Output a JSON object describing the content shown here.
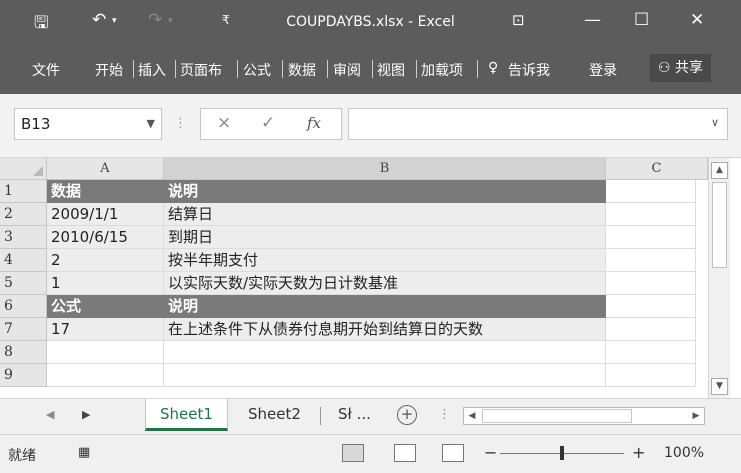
{
  "titlebar": {
    "save_icon": "save-icon",
    "undo_icon": "undo-icon",
    "redo_icon": "redo-icon",
    "title": "COUPDAYBS.xlsx - Excel",
    "ribbon_display_icon": "ribbon-display-icon",
    "minimize_icon": "minimize-icon",
    "maximize_icon": "maximize-icon",
    "close_icon": "close-icon"
  },
  "ribbon": {
    "tabs": [
      "文件",
      "开始",
      "插入",
      "页面布",
      "公式",
      "数据",
      "审阅",
      "视图",
      "加载项"
    ],
    "tell_me": "告诉我",
    "login": "登录",
    "share": "共享"
  },
  "formula_bar": {
    "name_box": "B13",
    "cancel": "×",
    "enter": "✓",
    "fx": "fx",
    "formula": ""
  },
  "columns": [
    "A",
    "B",
    "C"
  ],
  "rows": [
    {
      "num": "1",
      "a": "数据",
      "b": "说明",
      "style": "hdr"
    },
    {
      "num": "2",
      "a": "2009/1/1",
      "b": "结算日",
      "style": "data"
    },
    {
      "num": "3",
      "a": "2010/6/15",
      "b": "到期日",
      "style": "data"
    },
    {
      "num": "4",
      "a": "2",
      "b": "按半年期支付",
      "style": "data"
    },
    {
      "num": "5",
      "a": "1",
      "b": "以实际天数/实际天数为日计数基准",
      "style": "data"
    },
    {
      "num": "6",
      "a": "公式",
      "b": "说明",
      "style": "hdr"
    },
    {
      "num": "7",
      "a": "17",
      "b": "在上述条件下从债券付息期开始到结算日的天数",
      "style": "data"
    },
    {
      "num": "8",
      "a": "",
      "b": "",
      "style": ""
    },
    {
      "num": "9",
      "a": "",
      "b": "",
      "style": ""
    }
  ],
  "sheets": {
    "tabs": [
      "Sheet1",
      "Sheet2",
      "Sł ..."
    ],
    "active": 0
  },
  "status": {
    "mode": "就绪",
    "zoom": "100%",
    "zoom_level_percent": 100
  }
}
